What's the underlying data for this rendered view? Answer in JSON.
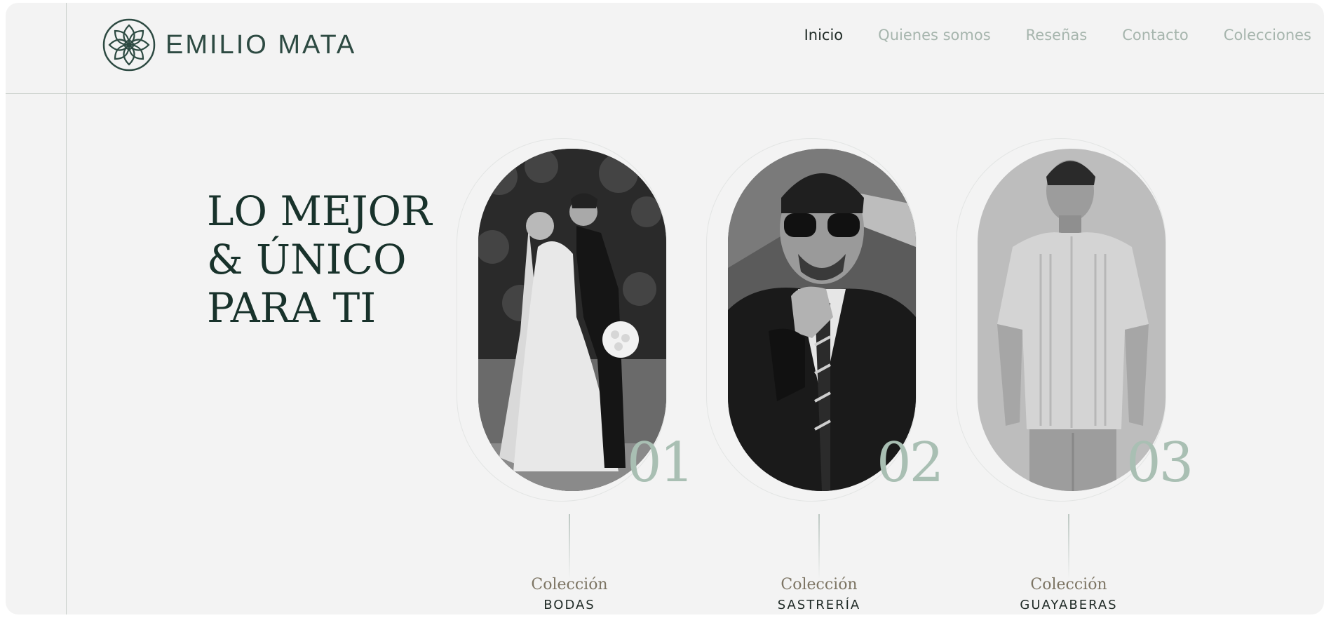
{
  "brand": {
    "name": "EMILIO MATA",
    "logo_icon": "flower-knot-icon",
    "color": "#2d4a42"
  },
  "nav": {
    "items": [
      {
        "label": "Inicio",
        "active": true
      },
      {
        "label": "Quienes somos",
        "active": false
      },
      {
        "label": "Reseñas",
        "active": false
      },
      {
        "label": "Contacto",
        "active": false
      },
      {
        "label": "Colecciones",
        "active": false
      }
    ]
  },
  "hero": {
    "lines": [
      "LO MEJOR",
      "& ÚNICO",
      "PARA TI"
    ]
  },
  "collections": [
    {
      "number": "01",
      "label": "Colección",
      "name": "BODAS",
      "image": "wedding-couple-kiss-photo"
    },
    {
      "number": "02",
      "label": "Colección",
      "name": "SASTRERÍA",
      "image": "man-suit-sunglasses-photo"
    },
    {
      "number": "03",
      "label": "Colección",
      "name": "GUAYABERAS",
      "image": "man-guayabera-shirt-photo"
    }
  ],
  "colors": {
    "background": "#f3f3f3",
    "accent": "#a9bfb3",
    "text_dark": "#18322b",
    "nav_muted": "#a6b5ad"
  }
}
